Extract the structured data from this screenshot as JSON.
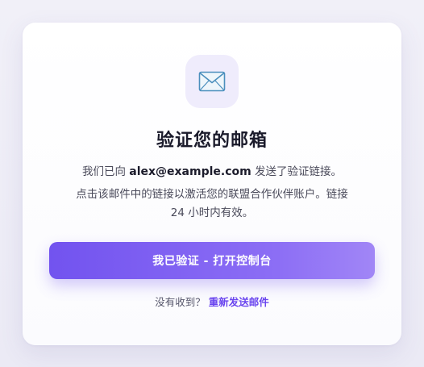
{
  "icon": "envelope-icon",
  "title": "验证您的邮箱",
  "message": {
    "prefix": "我们已向 ",
    "email": "alex@example.com",
    "suffix": " 发送了验证链接。",
    "instructions": "点击该邮件中的链接以激活您的联盟合作伙伴账户。链接 24 小时内有效。"
  },
  "primary_button": {
    "label": "我已验证 - 打开控制台"
  },
  "resend": {
    "prompt": "没有收到？",
    "link_label": "重新发送邮件"
  },
  "colors": {
    "accent": "#7253ef",
    "link": "#6a45ef",
    "icon_bg": "#efecfc"
  }
}
